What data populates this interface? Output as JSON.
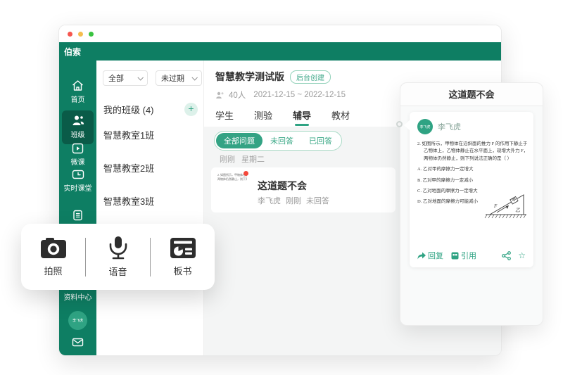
{
  "window": {
    "app_title": "伯索"
  },
  "sidebar": {
    "items": [
      {
        "label": "首页"
      },
      {
        "label": "班级"
      },
      {
        "label": "微课"
      },
      {
        "label": "实时课堂"
      },
      {
        "label": ""
      },
      {
        "label": "资料中心"
      }
    ],
    "avatar_text": "李飞虎"
  },
  "class_panel": {
    "filters": [
      {
        "value": "全部"
      },
      {
        "value": "未过期"
      }
    ],
    "group_title": "我的班级 (4)",
    "add_label": "+",
    "classes": [
      "智慧教室1班",
      "智慧教室2班",
      "智慧教室3班"
    ]
  },
  "main": {
    "course_title": "智慧教学测试版",
    "badge": "后台创建",
    "member_count": "40人",
    "date_range": "2021-12-15 ~ 2022-12-15",
    "tabs": [
      {
        "label": "学生"
      },
      {
        "label": "测验"
      },
      {
        "label": "辅导"
      },
      {
        "label": "教材"
      }
    ],
    "pills": [
      {
        "label": "全部问题"
      },
      {
        "label": "未回答"
      },
      {
        "label": "已回答"
      }
    ],
    "timeline": [
      "刚刚",
      "星期二"
    ],
    "question_card": {
      "title": "这道题不会",
      "meta": [
        "李飞虎",
        "刚刚",
        "未回答"
      ]
    }
  },
  "popup": {
    "title": "这道题不会",
    "author": "李飞虎",
    "avatar_text": "李飞虎",
    "question": {
      "stem_lines": [
        "2. 如图所示，甲物体在沿斜面的推力 F 的作用下静止于",
        "乙物体上，乙物体静止在水平面上，现增大外力 F，",
        "两物体仍然静止，则下列说法正确的是（  ）"
      ],
      "options": [
        "A.  乙对甲的摩擦力一定增大",
        "B.  乙对甲的摩擦力一定减小",
        "C.  乙对地面的摩擦力一定增大",
        "D.  乙对地面的摩擦力可能减小"
      ],
      "diagram_labels": {
        "block": "甲",
        "wedge": "乙",
        "force": "F"
      }
    },
    "actions": {
      "reply": "回复",
      "quote": "引用"
    }
  },
  "toolbar": {
    "items": [
      {
        "label": "拍照"
      },
      {
        "label": "语音"
      },
      {
        "label": "板书"
      }
    ]
  },
  "colors": {
    "teal": "#0e7e63",
    "teal_dark": "#0a5b48",
    "accent": "#2fa383",
    "badge_border": "#93d2ba",
    "bg_grey": "#f4f5f5",
    "red_dot": "#f4473a",
    "traffic_red": "#f6564f",
    "traffic_yellow": "#f5bd4e",
    "traffic_green": "#39c340"
  }
}
